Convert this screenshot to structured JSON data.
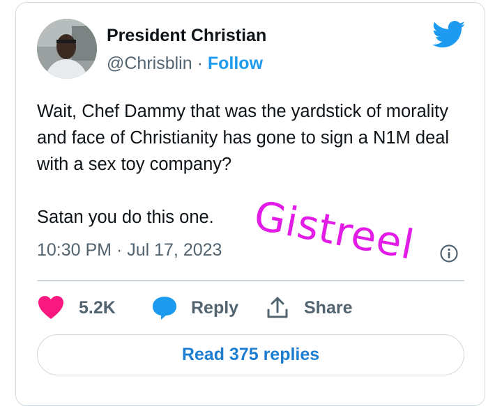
{
  "tweet": {
    "author_name": "President Christian",
    "handle": "@Chrisblin",
    "separator": " · ",
    "follow_label": "Follow",
    "text_paragraphs": [
      "Wait, Chef Dammy that was the yardstick of morality and face of Christianity has gone to sign a N1M deal with a sex toy company?",
      "Satan you do this one."
    ],
    "timestamp": "10:30 PM · Jul 17, 2023"
  },
  "actions": {
    "likes": "5.2K",
    "reply_label": "Reply",
    "share_label": "Share"
  },
  "read_replies_label": "Read 375 replies",
  "watermark": "Gistreel",
  "colors": {
    "brand_blue": "#1d9bf0",
    "like_pink": "#f91880",
    "watermark_magenta": "#e21be6",
    "muted_text": "#536471",
    "border": "#cfd9de"
  },
  "icons": [
    "twitter-bird-icon",
    "info-icon",
    "heart-icon",
    "reply-bubble-icon",
    "share-icon"
  ]
}
